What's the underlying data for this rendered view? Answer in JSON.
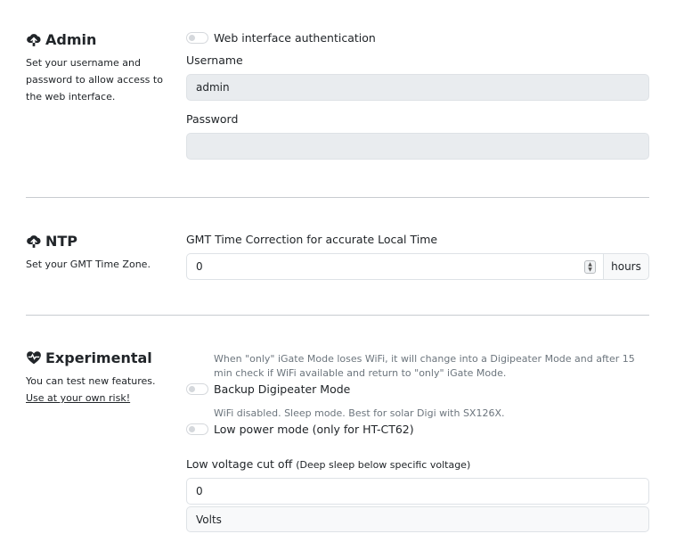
{
  "admin": {
    "title": "Admin",
    "icon": "cloud-upload-icon",
    "description": "Set your username and password to allow access to the web interface.",
    "auth_toggle_label": "Web interface authentication",
    "username_label": "Username",
    "username_value": "admin",
    "password_label": "Password",
    "password_value": ""
  },
  "ntp": {
    "title": "NTP",
    "icon": "cloud-upload-icon",
    "description": "Set your GMT Time Zone.",
    "gmt_label": "GMT Time Correction for accurate Local Time",
    "gmt_value": "0",
    "gmt_unit": "hours"
  },
  "experimental": {
    "title": "Experimental",
    "icon": "heart-pulse-icon",
    "description_prefix": "You can test new features. ",
    "description_link": "Use at your own risk!",
    "backup_help": "When \"only\" iGate Mode loses WiFi, it will change into a Digipeater Mode and after 15 min check if WiFi available and return to \"only\" iGate Mode.",
    "backup_label": "Backup Digipeater Mode",
    "lowpower_help": "WiFi disabled. Sleep mode. Best for solar Digi with SX126X.",
    "lowpower_label": "Low power mode (only for HT-CT62)",
    "voltage_label": "Low voltage cut off",
    "voltage_label_small": "(Deep sleep below specific voltage)",
    "voltage_value": "0",
    "voltage_unit": "Volts"
  }
}
